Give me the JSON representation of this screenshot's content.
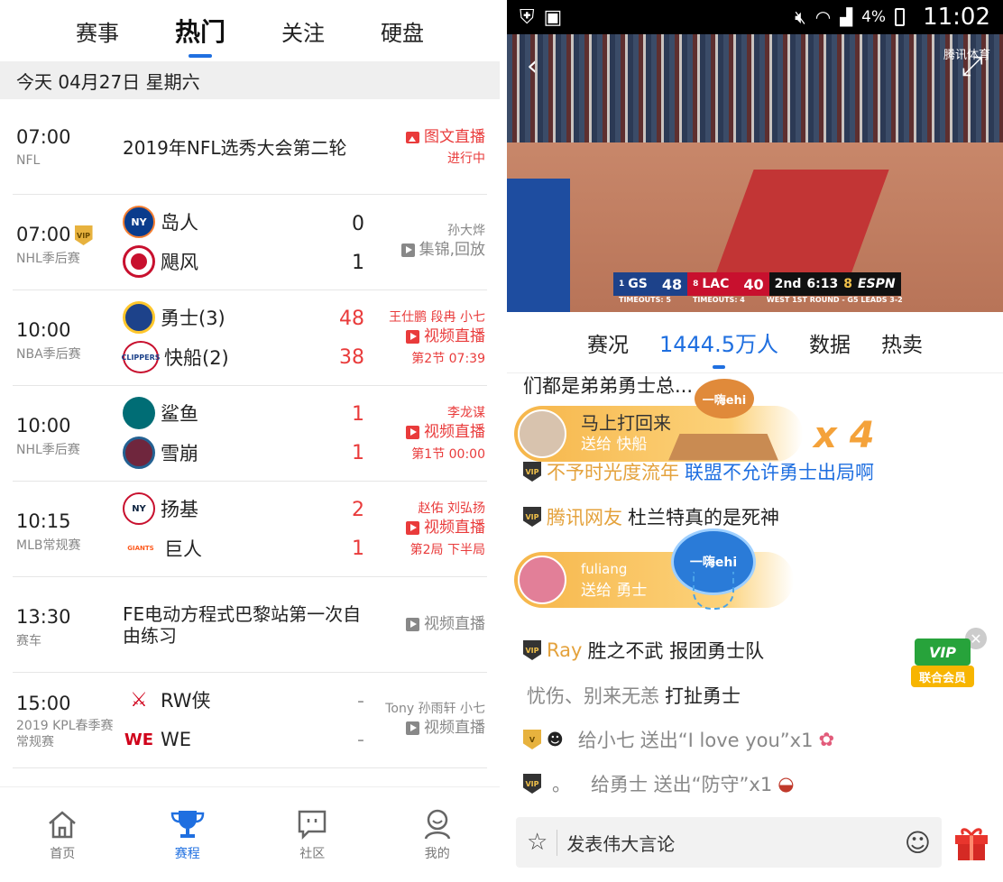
{
  "left": {
    "tabs": [
      {
        "label": "赛事",
        "active": false
      },
      {
        "label": "热门",
        "active": true
      },
      {
        "label": "关注",
        "active": false
      },
      {
        "label": "硬盘",
        "active": false
      }
    ],
    "date": "今天 04月27日 星期六",
    "matches": [
      {
        "time": "07:00",
        "league": "NFL",
        "title": "2019年NFL选秀大会第二轮",
        "action": "图文直播",
        "status": "进行中"
      },
      {
        "time": "07:00",
        "league": "NHL季后赛",
        "home": "岛人",
        "away": "飓风",
        "home_score": "0",
        "away_score": "1",
        "commentators": "孙大烨",
        "action": "集锦,回放"
      },
      {
        "time": "10:00",
        "league": "NBA季后赛",
        "home": "勇士(3)",
        "away": "快船(2)",
        "home_score": "48",
        "away_score": "38",
        "commentators": "王仕鹏 段冉 小七",
        "action": "视频直播",
        "status": "第2节 07:39"
      },
      {
        "time": "10:00",
        "league": "NHL季后赛",
        "home": "鲨鱼",
        "away": "雪崩",
        "home_score": "1",
        "away_score": "1",
        "commentators": "李龙谋",
        "action": "视频直播",
        "status": "第1节 00:00"
      },
      {
        "time": "10:15",
        "league": "MLB常规赛",
        "home": "扬基",
        "away": "巨人",
        "home_score": "2",
        "away_score": "1",
        "commentators": "赵佑 刘弘扬",
        "action": "视频直播",
        "status": "第2局 下半局"
      },
      {
        "time": "13:30",
        "league": "赛车",
        "title": "FE电动方程式巴黎站第一次自由练习",
        "action": "视频直播"
      },
      {
        "time": "15:00",
        "league": "2019 KPL春季赛常规赛",
        "home": "RW侠",
        "away": "WE",
        "home_score": "-",
        "away_score": "-",
        "commentators": "Tony 孙雨轩 小七",
        "action": "视频直播"
      }
    ],
    "logos": {
      "ny": "NY",
      "clippers": "CLIPPERS",
      "giants": "GIANTS",
      "we": "WE"
    },
    "bottom_nav": [
      {
        "label": "首页",
        "icon": "home-icon",
        "active": false
      },
      {
        "label": "赛程",
        "icon": "trophy-icon",
        "active": true
      },
      {
        "label": "社区",
        "icon": "community-icon",
        "active": false
      },
      {
        "label": "我的",
        "icon": "profile-icon",
        "active": false
      }
    ]
  },
  "right": {
    "status": {
      "battery": "4%",
      "time": "11:02"
    },
    "video": {
      "brand": "腾讯体育",
      "scorebug": {
        "away_rank": "1",
        "away": "GS",
        "away_score": "48",
        "home_rank": "8",
        "home": "LAC",
        "home_score": "40",
        "period": "2nd",
        "clock": "6:13",
        "shot": "8",
        "network": "ESPN",
        "away_timeouts": "TIMEOUTS: 5",
        "home_timeouts": "TIMEOUTS: 4",
        "series": "WEST 1ST ROUND - G5 LEADS 3-2"
      }
    },
    "tabs": [
      {
        "label": "赛况",
        "active": false
      },
      {
        "label": "1444.5万人",
        "active": true
      },
      {
        "label": "数据",
        "active": false
      },
      {
        "label": "热卖",
        "active": false
      }
    ],
    "chat": {
      "partial_line": "们都是弟弟勇士总...",
      "messages": [
        {
          "user": "不予时光度流年",
          "text": "联盟不允许勇士出局啊",
          "vip": true
        },
        {
          "user": "腾讯网友",
          "text": "杜兰特真的是死神",
          "vip": true
        },
        {
          "user": "Ray",
          "text": "胜之不武 报团勇士队",
          "vip": true
        },
        {
          "user": "忧伤、别来无恙",
          "text": "打扯勇士",
          "vip": false
        },
        {
          "user": "给小七",
          "text": "送出“I love you”x1",
          "vip": true
        },
        {
          "user": "。",
          "text": "给勇士 送出“防守”x1",
          "vip": true
        }
      ],
      "gifts": [
        {
          "name": "马上打回来",
          "sub": "送给 快船",
          "multiplier": "x 4",
          "gift_label": "一嗨ehi"
        },
        {
          "name": "fuliang",
          "sub": "送给 勇士",
          "gift_label": "一嗨ehi"
        }
      ],
      "vip_badge": {
        "top": "VIP",
        "bottom": "联合会员"
      }
    },
    "input_placeholder": "发表伟大言论"
  }
}
